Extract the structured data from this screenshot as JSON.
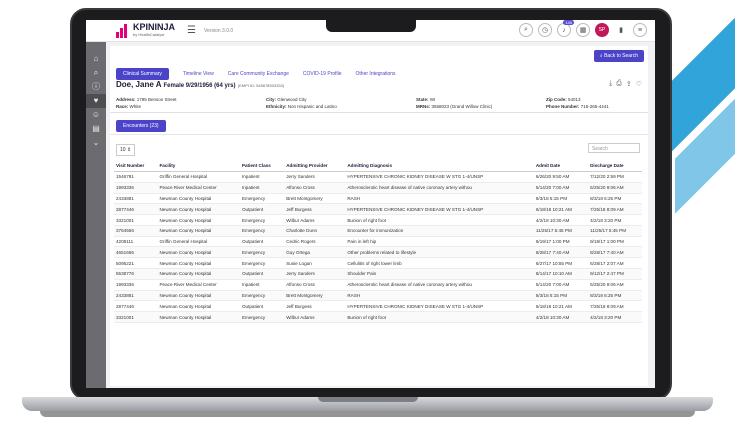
{
  "app": {
    "logo_name": "KPININJA",
    "logo_sub": "by HealthCatalyst",
    "version": "Version 3.0.0",
    "notification_count": "145",
    "avatar_initials": "SP"
  },
  "actions": {
    "back": "Back to Search"
  },
  "tabs": [
    "Clinical Summary",
    "Timeline View",
    "Care Community Exchange",
    "COVID-19 Profile",
    "Other Integrations"
  ],
  "patient": {
    "name": "Doe, Jane A",
    "summary": "Female 9/29/1956 (64 yrs)",
    "empi": "(EMPI ID: 545678903333)",
    "address_label": "Address:",
    "address": "1795 Benson Street",
    "race_label": "Race:",
    "race": "White",
    "city_label": "City:",
    "city": "Glenwood City",
    "ethnicity_label": "Ethnicity:",
    "ethnicity": "Non Hispanic and Latino",
    "state_label": "State:",
    "state": "WI",
    "mrns_label": "MRNs:",
    "mrns": "3558023 (Grand Willow Clinic)",
    "zip_label": "Zip Code:",
    "zip": "54013",
    "phone_label": "Phone Number:",
    "phone": "715-265-4441"
  },
  "encounters": {
    "button": "Encounters (23)",
    "page_length": "10",
    "search_placeholder": "Search",
    "columns": [
      "Visit Number",
      "Facility",
      "Patient Class",
      "Admitting Provider",
      "Admitting Diagnosis",
      "Admit Date",
      "Discharge Date"
    ],
    "rows": [
      [
        "1546781",
        "Griffin General Hospital",
        "Inpatient",
        "Jerry Sanders",
        "HYPERTENSIVE CHRONIC KIDNEY DISEASE W STG 1-4/UNSP",
        "6/26/20 9:50 AM",
        "7/12/20 2:59 PM"
      ],
      [
        "1993336",
        "Peace River Medical Center",
        "Inpatient",
        "Alfonso Cross",
        "Atherosclerotic heart disease of native coronary artery withou",
        "5/14/20 7:00 AM",
        "5/25/20 9:06 AM"
      ],
      [
        "2433881",
        "Newman County Hospital",
        "Emergency",
        "Brett Montgomery",
        "RASH",
        "8/3/18 5:15 PM",
        "8/3/18 6:25 PM"
      ],
      [
        "2877446",
        "Newman County Hospital",
        "Outpatient",
        "Jeff Burgess",
        "HYPERTENSIVE CHRONIC KIDNEY DISEASE W STG 1-4/UNSP",
        "6/18/18 10:21 AM",
        "7/25/18 8:09 AM"
      ],
      [
        "3321001",
        "Newman County Hospital",
        "Emergency",
        "Wilbur Adams",
        "Bunion of right foot",
        "4/2/18 10:30 AM",
        "4/2/18 3:20 PM"
      ],
      [
        "3764556",
        "Newman County Hospital",
        "Emergency",
        "Charlotte Dunn",
        "Encounter for immunization",
        "11/25/17 5:45 PM",
        "11/25/17 5:45 PM"
      ],
      [
        "4208111",
        "Griffin General Hospital",
        "Outpatient",
        "Cedric Rogers",
        "Pain in left hip",
        "9/19/17 1:00 PM",
        "9/19/17 1:00 PM"
      ],
      [
        "4651666",
        "Newman County Hospital",
        "Emergency",
        "Guy Ortega",
        "Other problems related to lifestyle",
        "8/28/17 7:40 AM",
        "8/28/17 7:40 AM"
      ],
      [
        "5095221",
        "Newman County Hospital",
        "Emergency",
        "Susie Logan",
        "Cellulitis of right lower limb",
        "6/27/17 10:55 PM",
        "6/28/17 2:07 AM"
      ],
      [
        "5538776",
        "Newman County Hospital",
        "Outpatient",
        "Jerry Sanders",
        "Shoulder Pain",
        "8/14/17 10:10 AM",
        "9/12/17 2:47 PM"
      ],
      [
        "1993336",
        "Peace River Medical Center",
        "Inpatient",
        "Alfonso Cross",
        "Atherosclerotic heart disease of native coronary artery withou",
        "5/14/20 7:00 AM",
        "5/25/20 9:06 AM"
      ],
      [
        "2433881",
        "Newman County Hospital",
        "Emergency",
        "Brett Montgomery",
        "RASH",
        "8/3/18 5:15 PM",
        "8/3/18 6:25 PM"
      ],
      [
        "2877446",
        "Newman County Hospital",
        "Outpatient",
        "Jeff Burgess",
        "HYPERTENSIVE CHRONIC KIDNEY DISEASE W STG 1-4/UNSP",
        "6/18/18 10:21 AM",
        "7/25/18 8:09 AM"
      ],
      [
        "3321001",
        "Newman County Hospital",
        "Emergency",
        "Wilbur Adams",
        "Bunion of right foot",
        "4/2/18 10:30 AM",
        "4/2/18 3:20 PM"
      ]
    ]
  },
  "colors": {
    "accent": "#4b44c9",
    "brand": "#e3007a",
    "sidebar": "#6b6b70"
  }
}
